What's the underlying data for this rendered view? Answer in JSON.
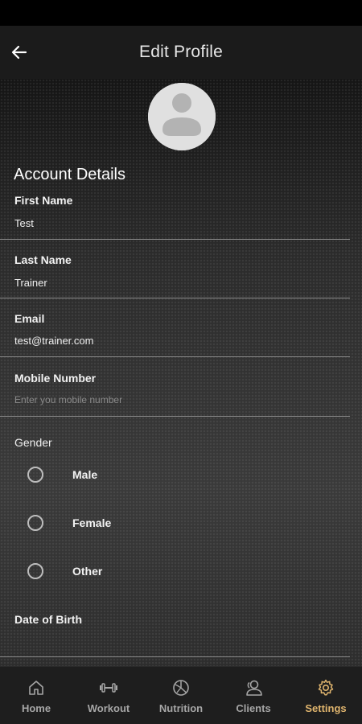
{
  "app_bar": {
    "title": "Edit Profile",
    "back_icon": "arrow-left-icon"
  },
  "avatar": {
    "icon": "user-placeholder-icon"
  },
  "account": {
    "section_title": "Account Details",
    "first_name": {
      "label": "First Name",
      "value": "Test"
    },
    "last_name": {
      "label": "Last Name",
      "value": "Trainer"
    },
    "email": {
      "label": "Email",
      "value": "test@trainer.com"
    },
    "mobile": {
      "label": "Mobile Number",
      "value": "",
      "placeholder": "Enter you mobile number"
    },
    "gender": {
      "label": "Gender",
      "options": [
        "Male",
        "Female",
        "Other"
      ],
      "selected": null
    },
    "dob": {
      "label": "Date of Birth",
      "value": ""
    }
  },
  "nav": {
    "items": [
      {
        "label": "Home",
        "icon": "home-icon",
        "active": false
      },
      {
        "label": "Workout",
        "icon": "dumbbell-icon",
        "active": false
      },
      {
        "label": "Nutrition",
        "icon": "nutrition-icon",
        "active": false
      },
      {
        "label": "Clients",
        "icon": "clients-icon",
        "active": false
      },
      {
        "label": "Settings",
        "icon": "gear-icon",
        "active": true
      }
    ],
    "active_color": "#e0b56e",
    "inactive_color": "#a6a6a6"
  }
}
